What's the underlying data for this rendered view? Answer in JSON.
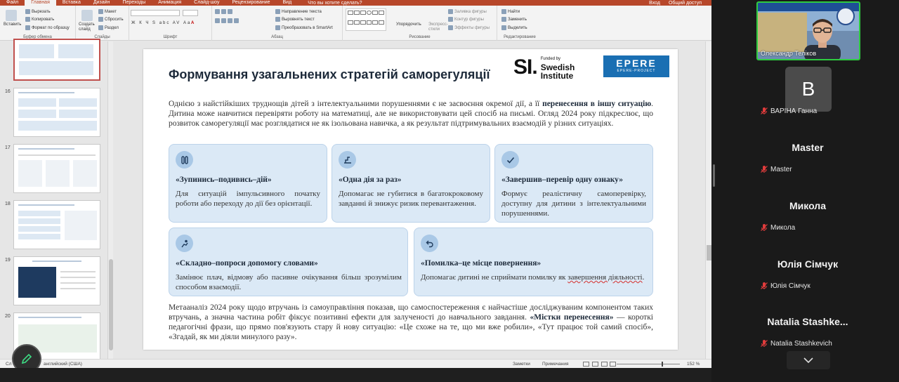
{
  "ppt": {
    "tabs": [
      "Файл",
      "Главная",
      "Вставка",
      "Дизайн",
      "Переходы",
      "Анимация",
      "Слайд-шоу",
      "Рецензирование",
      "Вид"
    ],
    "active_tab": "Главная",
    "search_placeholder": "Что вы хотите сделать?",
    "sign_in": "Вход",
    "share": "Общий доступ",
    "ribbon": {
      "clipboard": {
        "paste": "Вставить",
        "cut": "Вырезать",
        "copy": "Копировать",
        "format_painter": "Формат по образцу",
        "label": "Буфер обмена"
      },
      "slides": {
        "new_slide": "Создать слайд",
        "layout": "Макет",
        "reset": "Сбросить",
        "section": "Раздел",
        "label": "Слайды"
      },
      "font": {
        "label": "Шрифт",
        "styles": "Ж К Ч S abc AV Аа",
        "colors": "A"
      },
      "paragraph": {
        "text_direction": "Направление текста",
        "align_text": "Выровнять текст",
        "smartart": "Преобразовать в SmartArt",
        "label": "Абзац"
      },
      "drawing": {
        "arrange": "Упорядочить",
        "quick_styles": "Экспресс-стили",
        "fill": "Заливка фигуры",
        "outline": "Контур фигуры",
        "effects": "Эффекты фигуры",
        "label": "Рисование"
      },
      "editing": {
        "find": "Найти",
        "replace": "Заменить",
        "select": "Выделить",
        "label": "Редактирование"
      }
    },
    "thumb_numbers": [
      "16",
      "17",
      "18",
      "19",
      "20"
    ],
    "status": {
      "slide_counter": "Сл",
      "language": "английский (США)",
      "notes": "Заметки",
      "comments": "Примечания",
      "zoom": "152 %",
      "zoom_level_pct": 152
    }
  },
  "slide": {
    "title": "Формування узагальнених стратегій саморегуляції",
    "logo_si": {
      "mark": "SI.",
      "funded": "Funded by",
      "swedish": "Swedish",
      "institute": "Institute"
    },
    "logo_epere": {
      "main": "EPERE",
      "sub": "EPERE-PROJECT"
    },
    "intro_a": "Однією з найстійкіших труднощів дітей з інтелектуальними порушеннями є не засвоєння окремої дії, а її ",
    "intro_bold": "перенесення в іншу ситуацію",
    "intro_b": ". Дитина може навчитися перевіряти роботу на математиці, але не використовувати цей спосіб на письмі. Огляд 2024 року підкреслює, що розвиток саморегуляції має розглядатися не як ізольована навичка, а як результат підтримувальних взаємодій у різних ситуаціях.",
    "cards": [
      {
        "icon": "pause-icon",
        "title": "«Зупинись–подивись–дій»",
        "text": "Для ситуацій імпульсивного початку роботи або переходу до дії без орієнтації."
      },
      {
        "icon": "step-icon",
        "title": "«Одна дія за раз»",
        "text": "Допомагає не губитися в багатокроковому завданні й знижує ризик перевантаження."
      },
      {
        "icon": "check-icon",
        "title": "«Завершив–перевір одну ознаку»",
        "text": "Формує реалістичну самоперевірку, доступну для дитини з інтелектуальними порушеннями."
      },
      {
        "icon": "help-icon",
        "title": "«Складно–попроси допомогу словами»",
        "text": "Замінює плач, відмову або пасивне очікування більш зрозумілим способом взаємодії."
      },
      {
        "icon": "return-icon",
        "title": "«Помилка–це місце повернення»",
        "text_a": "Допомагає дитині не сприймати помилку як ",
        "text_und": "завершення діяльності",
        "text_b": "."
      }
    ],
    "outro_a": "Метааналіз 2024 року щодо втручань із самоуправління показав, що самоспостереження є найчастіше досліджуваним компонентом таких втручань, а значна частина робіт фіксує позитивні ефекти для залученості до навчального завдання. ",
    "outro_bold": "«Містки перенесення»",
    "outro_b": " — короткі педагогічні фрази, що прямо пов'язують стару й нову ситуацію: «Це схоже на те, що ми вже робили», «Тут працює той самий спосіб», «Згадай, як ми діяли минулого разу»."
  },
  "participants": {
    "video_name": "Олександр Теліков",
    "avatar_letter": "B",
    "list": [
      {
        "big": "",
        "label": "ВАРІНА Ганна"
      },
      {
        "big": "Master",
        "label": "Master"
      },
      {
        "big": "Микола",
        "label": "Микола"
      },
      {
        "big": "Юлія Сімчук",
        "label": "Юлія Сімчук"
      },
      {
        "big": "Natalia Stashke...",
        "label": "Natalia Stashkevich"
      }
    ]
  },
  "colors": {
    "accent": "#b7472a",
    "card_bg": "#dbe9f6",
    "card_icon": "#a9c8e6",
    "active_speaker": "#2ecc40",
    "muted": "#e03c3c"
  }
}
